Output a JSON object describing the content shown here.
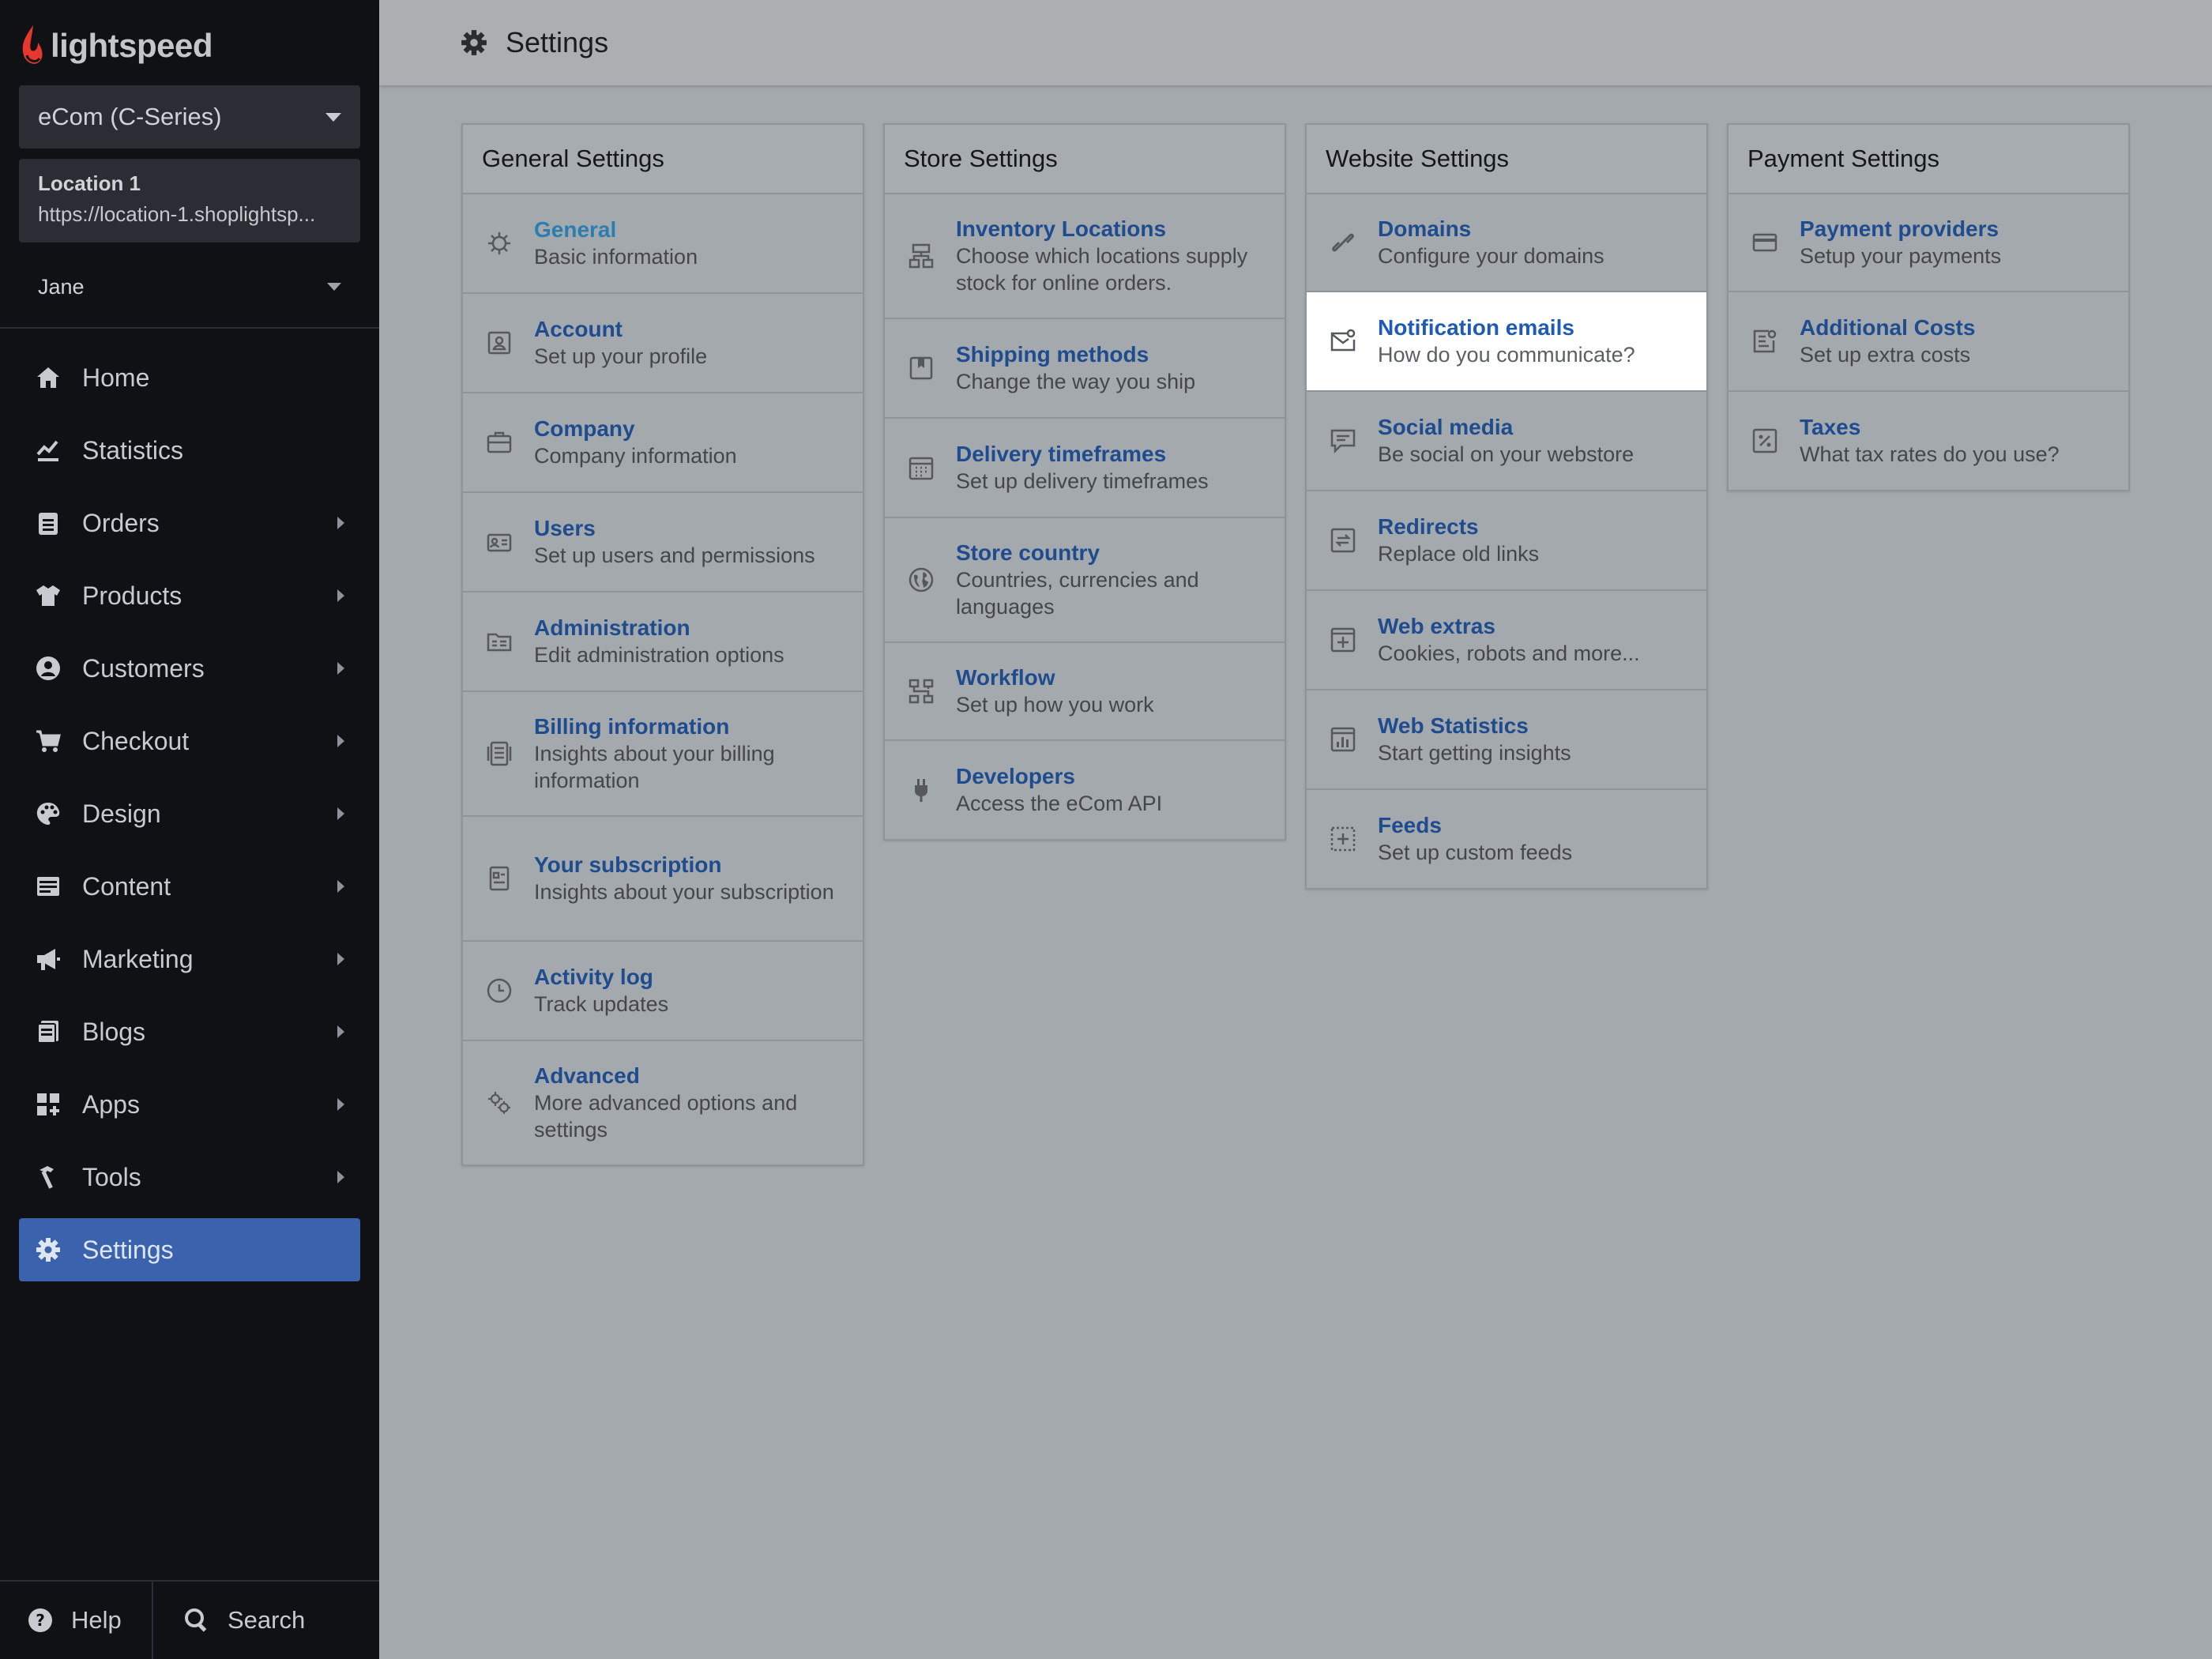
{
  "brand": {
    "name": "lightspeed",
    "accent": "#3a62ad",
    "logo_color": "#e8372f"
  },
  "sidebar": {
    "store_selector": "eCom (C-Series)",
    "location": {
      "name": "Location 1",
      "url": "https://location-1.shoplightsp..."
    },
    "user": "Jane",
    "nav": [
      {
        "label": "Home",
        "icon": "home-icon",
        "has_children": false
      },
      {
        "label": "Statistics",
        "icon": "chart-icon",
        "has_children": false
      },
      {
        "label": "Orders",
        "icon": "clipboard-icon",
        "has_children": true
      },
      {
        "label": "Products",
        "icon": "shirt-icon",
        "has_children": true
      },
      {
        "label": "Customers",
        "icon": "person-icon",
        "has_children": true
      },
      {
        "label": "Checkout",
        "icon": "cart-icon",
        "has_children": true
      },
      {
        "label": "Design",
        "icon": "palette-icon",
        "has_children": true
      },
      {
        "label": "Content",
        "icon": "content-icon",
        "has_children": true
      },
      {
        "label": "Marketing",
        "icon": "megaphone-icon",
        "has_children": true
      },
      {
        "label": "Blogs",
        "icon": "blog-icon",
        "has_children": true
      },
      {
        "label": "Apps",
        "icon": "apps-icon",
        "has_children": true
      },
      {
        "label": "Tools",
        "icon": "hammer-icon",
        "has_children": true
      },
      {
        "label": "Settings",
        "icon": "gear-icon",
        "has_children": false,
        "active": true
      }
    ],
    "help_label": "Help",
    "search_label": "Search"
  },
  "header": {
    "title": "Settings"
  },
  "sections": [
    {
      "title": "General Settings",
      "items": [
        {
          "title": "General",
          "desc": "Basic information",
          "icon": "gear-icon"
        },
        {
          "title": "Account",
          "desc": "Set up your profile",
          "icon": "account-icon"
        },
        {
          "title": "Company",
          "desc": "Company information",
          "icon": "briefcase-icon"
        },
        {
          "title": "Users",
          "desc": "Set up users and permissions",
          "icon": "users-icon"
        },
        {
          "title": "Administration",
          "desc": "Edit administration options",
          "icon": "folder-icon"
        },
        {
          "title": "Billing information",
          "desc": "Insights about your billing information",
          "icon": "receipt-icon"
        },
        {
          "title": "Your subscription",
          "desc": "Insights about your subscription",
          "icon": "document-icon"
        },
        {
          "title": "Activity log",
          "desc": "Track updates",
          "icon": "clock-icon"
        },
        {
          "title": "Advanced",
          "desc": "More advanced options and settings",
          "icon": "gears-icon"
        }
      ]
    },
    {
      "title": "Store Settings",
      "items": [
        {
          "title": "Inventory Locations",
          "desc": "Choose which locations supply stock for online orders.",
          "icon": "locations-icon"
        },
        {
          "title": "Shipping methods",
          "desc": "Change the way you ship",
          "icon": "box-icon"
        },
        {
          "title": "Delivery timeframes",
          "desc": "Set up delivery timeframes",
          "icon": "calendar-icon"
        },
        {
          "title": "Store country",
          "desc": "Countries, currencies and languages",
          "icon": "globe-icon"
        },
        {
          "title": "Workflow",
          "desc": "Set up how you work",
          "icon": "workflow-icon"
        },
        {
          "title": "Developers",
          "desc": "Access the eCom API",
          "icon": "plug-icon"
        }
      ]
    },
    {
      "title": "Website Settings",
      "items": [
        {
          "title": "Domains",
          "desc": "Configure your domains",
          "icon": "link-icon"
        },
        {
          "title": "Notification emails",
          "desc": "How do you communicate?",
          "icon": "mail-icon"
        },
        {
          "title": "Social media",
          "desc": "Be social on your webstore",
          "icon": "chat-icon"
        },
        {
          "title": "Redirects",
          "desc": "Replace old links",
          "icon": "redirect-icon"
        },
        {
          "title": "Web extras",
          "desc": "Cookies, robots and more...",
          "icon": "window-plus-icon"
        },
        {
          "title": "Web Statistics",
          "desc": "Start getting insights",
          "icon": "bar-chart-icon"
        },
        {
          "title": "Feeds",
          "desc": "Set up custom feeds",
          "icon": "feeds-icon"
        }
      ]
    },
    {
      "title": "Payment Settings",
      "items": [
        {
          "title": "Payment providers",
          "desc": "Setup your payments",
          "icon": "credit-card-icon"
        },
        {
          "title": "Additional Costs",
          "desc": "Set up extra costs",
          "icon": "costs-icon"
        },
        {
          "title": "Taxes",
          "desc": "What tax rates do you use?",
          "icon": "percent-icon"
        }
      ]
    }
  ]
}
